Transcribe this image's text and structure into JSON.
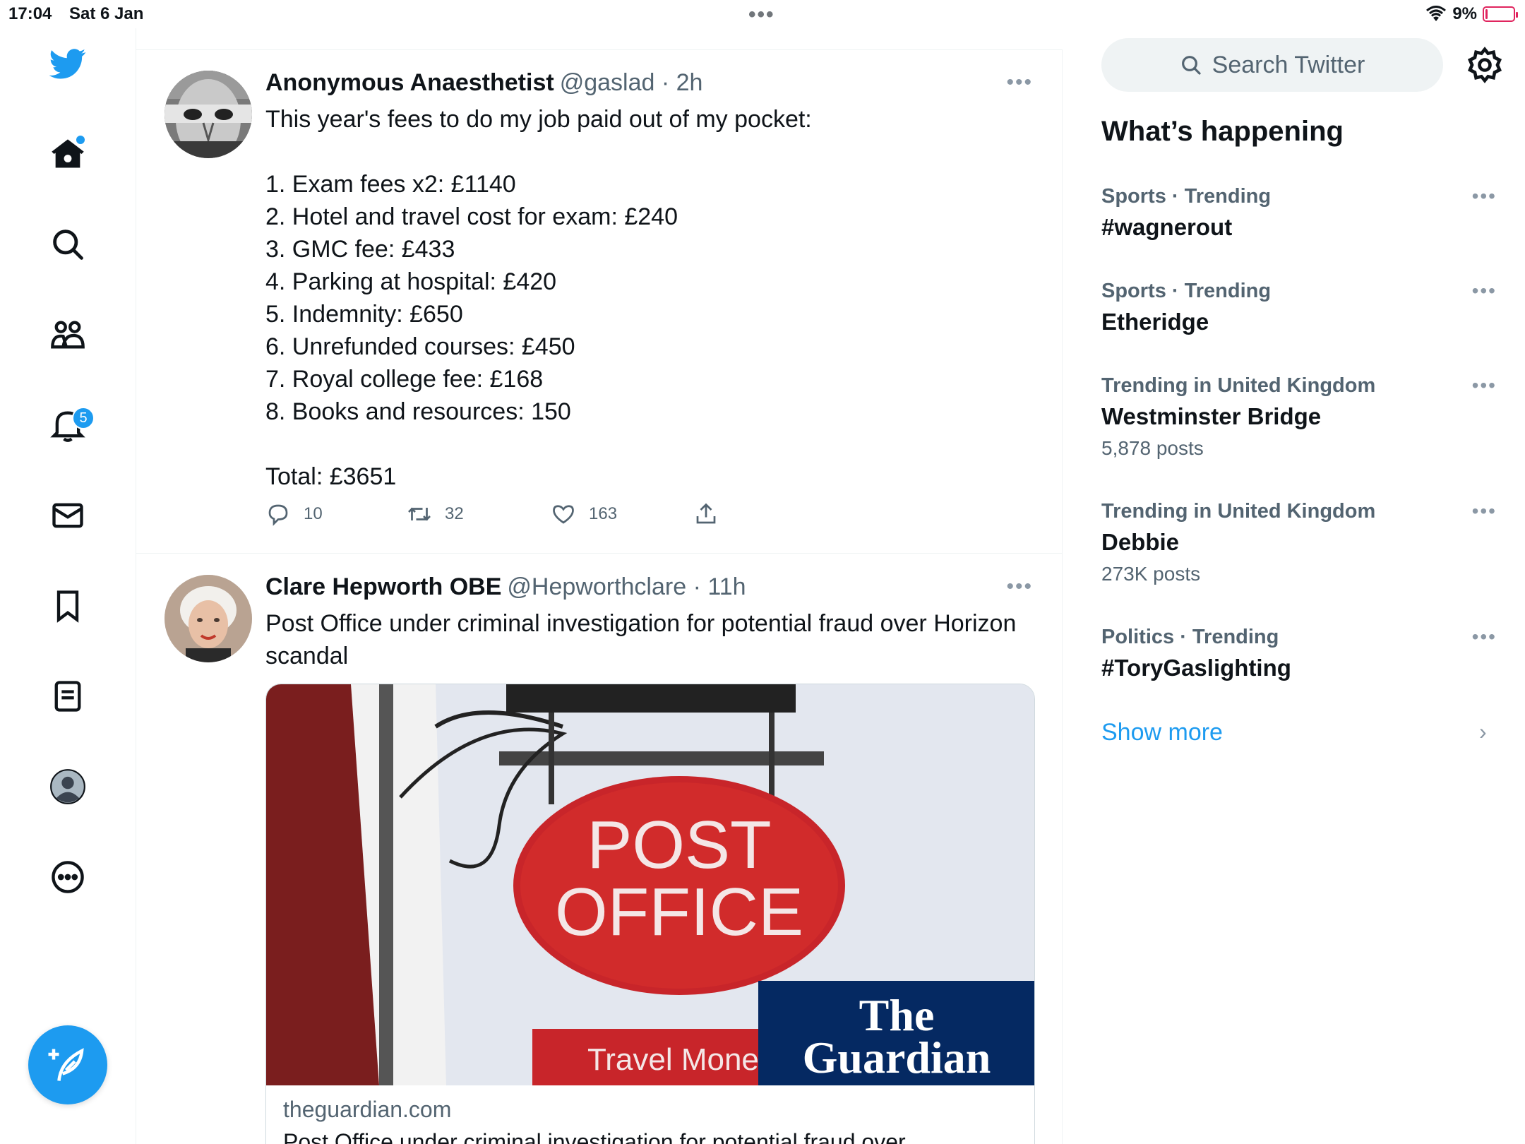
{
  "status_bar": {
    "time": "17:04",
    "date": "Sat 6 Jan",
    "battery_text": "9%",
    "battery_level": 0.09
  },
  "nav": {
    "items": [
      {
        "name": "home",
        "icon": "home-icon"
      },
      {
        "name": "explore",
        "icon": "search-icon"
      },
      {
        "name": "communities",
        "icon": "people-icon"
      },
      {
        "name": "notifications",
        "icon": "bell-icon",
        "badge": "5"
      },
      {
        "name": "messages",
        "icon": "envelope-icon"
      },
      {
        "name": "bookmarks",
        "icon": "bookmark-icon"
      },
      {
        "name": "lists",
        "icon": "list-icon"
      },
      {
        "name": "profile",
        "icon": "avatar-icon"
      },
      {
        "name": "more",
        "icon": "more-circle-icon"
      }
    ],
    "notifications_badge": "5",
    "compose_icon": "feather-plus-icon"
  },
  "tweets": [
    {
      "name": "Anonymous Anaesthetist",
      "handle": "@gaslad",
      "time": "· 2h",
      "lines": [
        "This year's fees to do my job paid out of my pocket:",
        "",
        "1. Exam fees x2: £1140",
        "2. Hotel and travel cost for exam: £240",
        "3. GMC fee: £433",
        "4. Parking at hospital: £420",
        "5. Indemnity: £650",
        "6. Unrefunded courses: £450",
        "7. Royal college fee: £168",
        "8. Books and resources: 150",
        "",
        "Total: £3651"
      ],
      "replies": "10",
      "retweets": "32",
      "likes": "163"
    },
    {
      "name": "Clare Hepworth OBE",
      "handle": "@Hepworthclare",
      "time": "· 11h",
      "text": "Post Office under criminal investigation for potential fraud over Horizon scandal",
      "card": {
        "sign_line1": "POST",
        "sign_line2": "OFFICE",
        "sign_sub": "Travel Money",
        "logo_line1": "The",
        "logo_line2": "Guardian",
        "domain": "theguardian.com",
        "title": "Post Office under criminal investigation for potential fraud over"
      }
    }
  ],
  "sidebar": {
    "search_placeholder": "Search Twitter",
    "whats_happening": "What’s happening",
    "trends": [
      {
        "meta": "Sports · Trending",
        "name": "#wagnerout",
        "count": ""
      },
      {
        "meta": "Sports · Trending",
        "name": "Etheridge",
        "count": ""
      },
      {
        "meta": "Trending in United Kingdom",
        "name": "Westminster Bridge",
        "count": "5,878 posts"
      },
      {
        "meta": "Trending in United Kingdom",
        "name": "Debbie",
        "count": "273K posts"
      },
      {
        "meta": "Politics · Trending",
        "name": "#ToryGaslighting",
        "count": ""
      }
    ],
    "show_more": "Show more"
  },
  "colors": {
    "accent": "#1d9bf0",
    "text": "#0f1419",
    "secondary": "#536471",
    "post_office_red": "#d12b2b",
    "guardian_blue": "#052962"
  }
}
